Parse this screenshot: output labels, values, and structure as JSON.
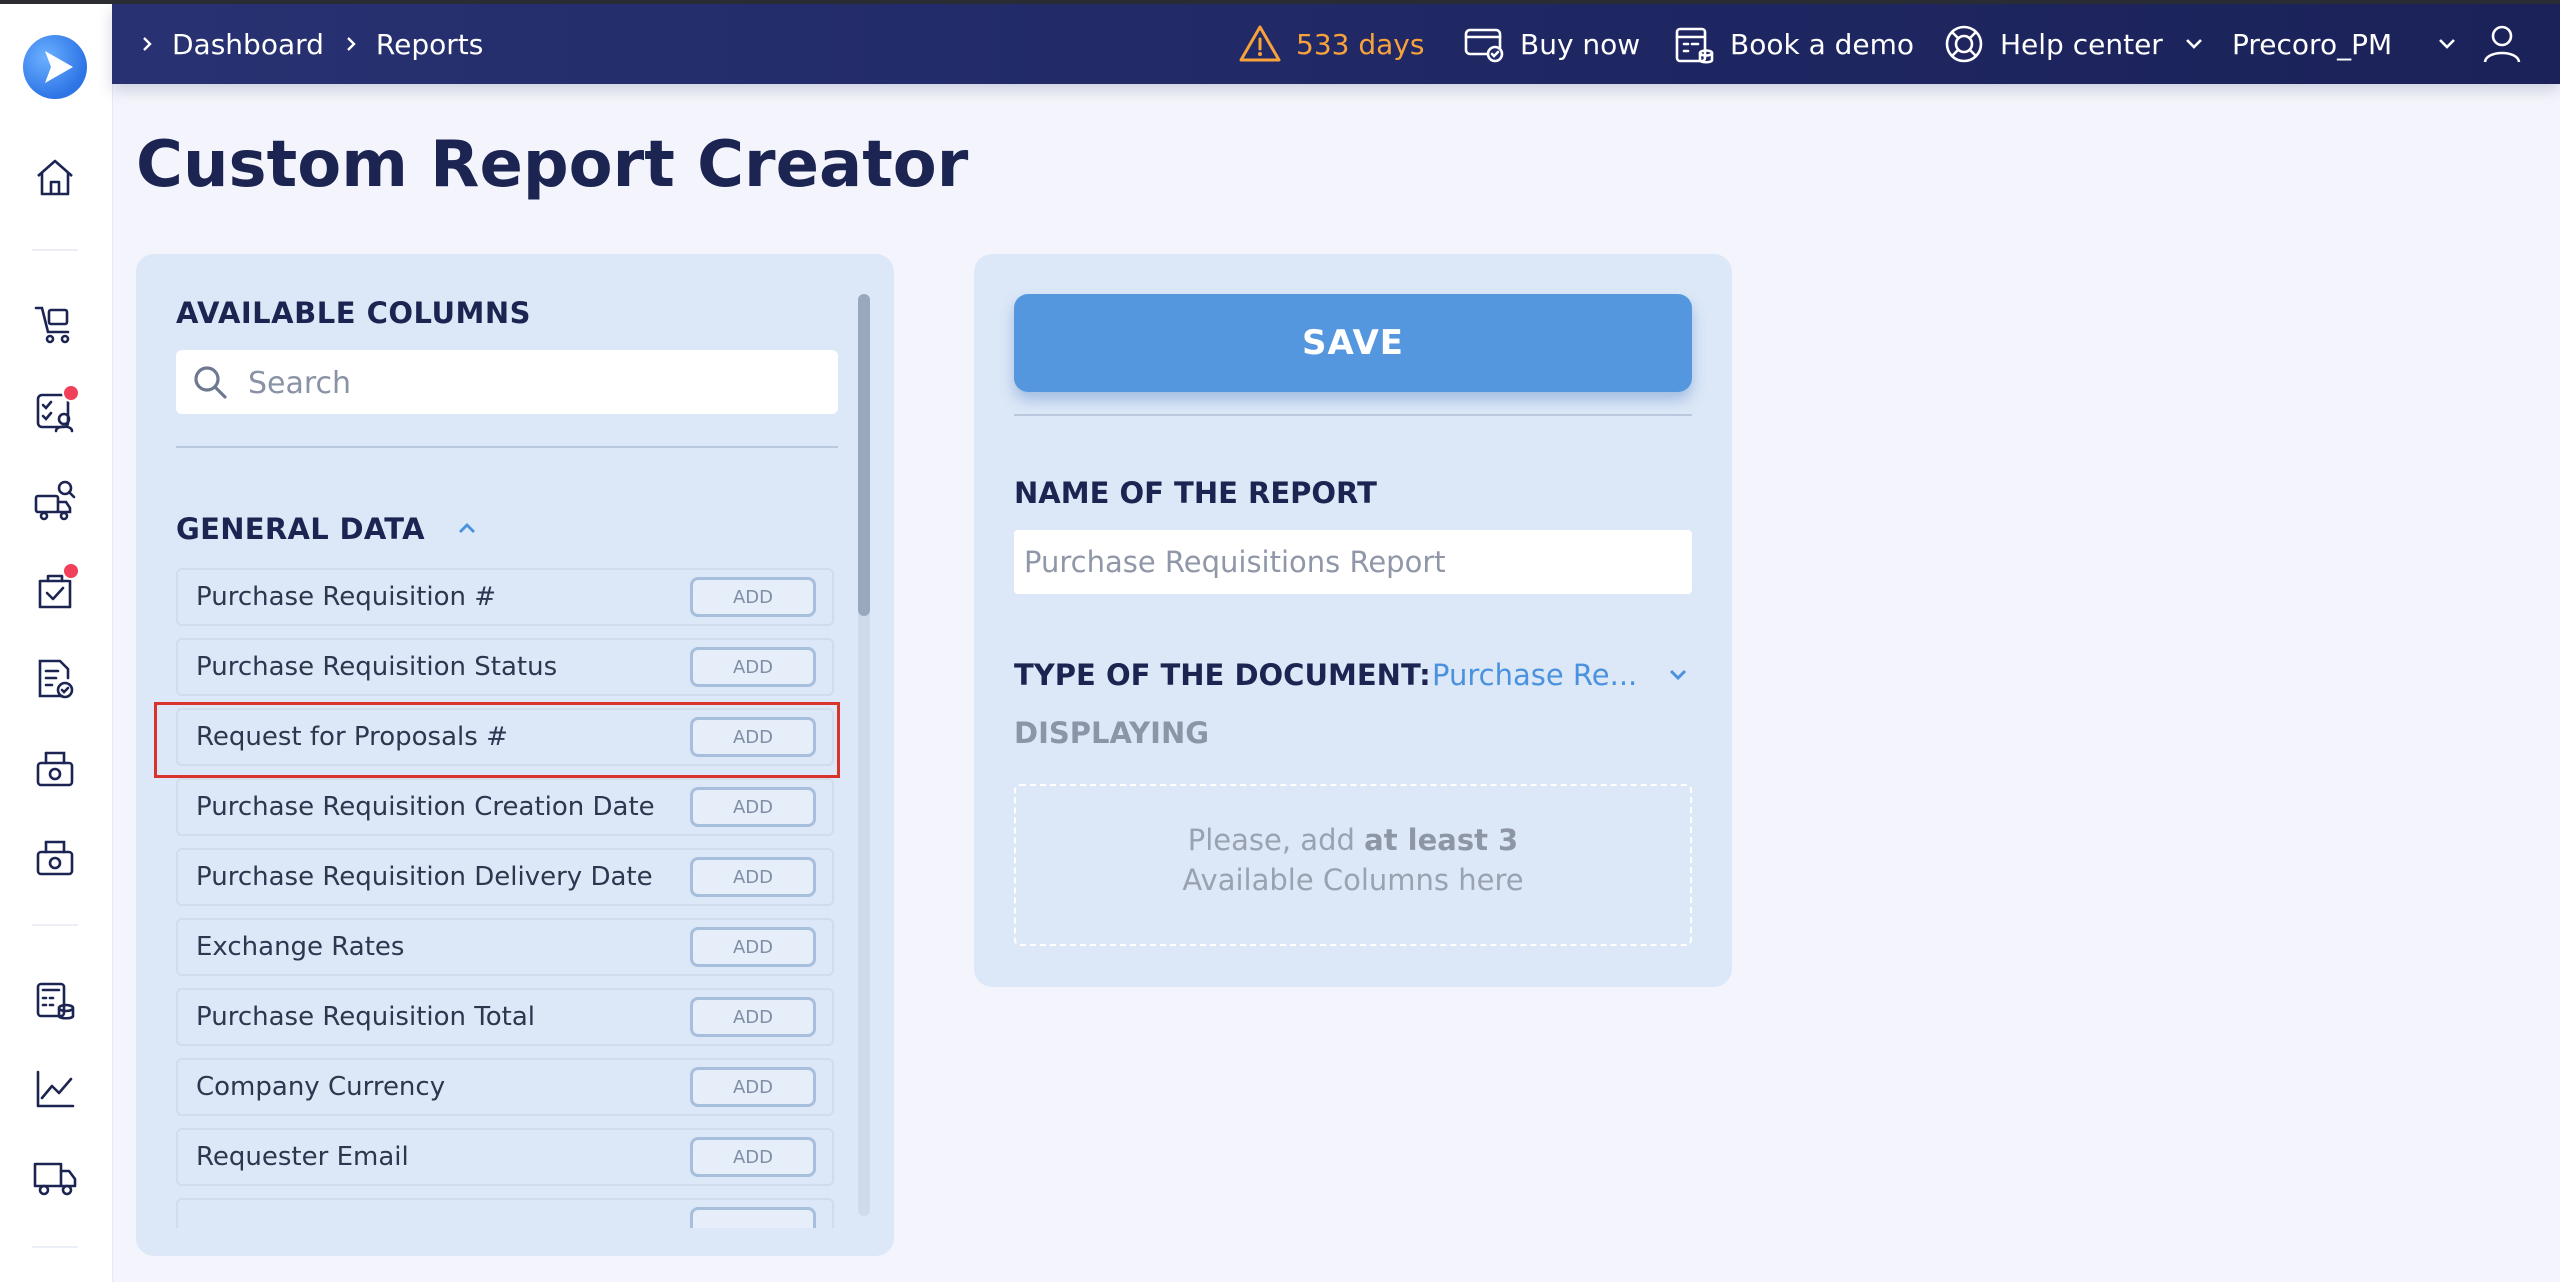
{
  "breadcrumb": {
    "items": [
      "Dashboard",
      "Reports"
    ]
  },
  "header": {
    "trial_days": "533 days",
    "buy_now": "Buy now",
    "book_demo": "Book a demo",
    "help_center": "Help center",
    "account": "Precoro_PM"
  },
  "page": {
    "title": "Custom Report Creator"
  },
  "available_columns": {
    "title": "AVAILABLE COLUMNS",
    "search_placeholder": "Search",
    "group_title": "GENERAL DATA",
    "add_label": "ADD",
    "items": [
      "Purchase Requisition #",
      "Purchase Requisition Status",
      "Request for Proposals #",
      "Purchase Requisition Creation Date",
      "Purchase Requisition Delivery Date",
      "Exchange Rates",
      "Purchase Requisition Total",
      "Company Currency",
      "Requester Email",
      ""
    ]
  },
  "report": {
    "save_label": "SAVE",
    "name_label": "NAME OF THE REPORT",
    "name_placeholder": "Purchase Requisitions Report",
    "type_label": "TYPE OF THE DOCUMENT:",
    "type_value": "Purchase Re...",
    "displaying_label": "DISPLAYING",
    "dropzone_pre": "Please, add ",
    "dropzone_bold": "at least 3",
    "dropzone_line2": "Available Columns here"
  },
  "colors": {
    "header": "#232c6a",
    "accent": "#5497df",
    "warning": "#f7a23b",
    "badge": "#f0405a",
    "highlight": "#d9342b"
  },
  "icons": [
    "logo-icon",
    "home-icon",
    "cart-icon",
    "approvals-icon",
    "suppliers-icon",
    "tasks-icon",
    "invoice-icon",
    "receipt-icon",
    "payment-icon",
    "budget-icon",
    "analytics-icon",
    "delivery-icon",
    "warning-icon",
    "buy-icon",
    "calendar-icon",
    "help-icon",
    "chevron-down-icon",
    "user-icon",
    "search-icon",
    "chevron-up-icon"
  ]
}
